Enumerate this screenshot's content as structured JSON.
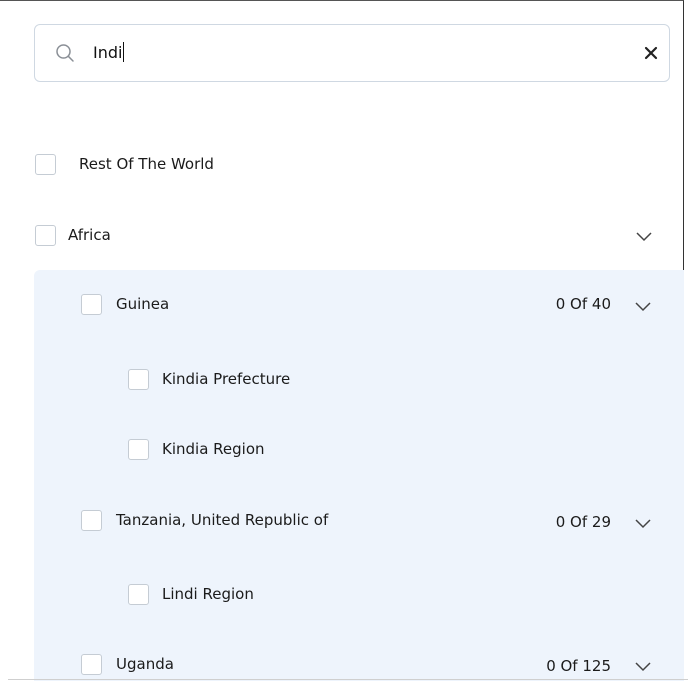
{
  "search": {
    "value": "Indi",
    "clear_icon": "close-icon",
    "search_icon": "search-icon"
  },
  "rows": {
    "rest": {
      "label": "Rest Of The World"
    },
    "africa": {
      "label": "Africa",
      "chevron": "chevron-down-icon"
    },
    "guinea": {
      "label": "Guinea",
      "count": "0 Of 40",
      "chevron": "chevron-down-icon"
    },
    "kindia_prefecture": {
      "label": "Kindia Prefecture"
    },
    "kindia_region": {
      "label": "Kindia Region"
    },
    "tanzania": {
      "label": "Tanzania, United Republic of",
      "count": "0 Of 29",
      "chevron": "chevron-down-icon"
    },
    "lindi_region": {
      "label": "Lindi Region"
    },
    "uganda": {
      "label": "Uganda",
      "count": "0 Of 125",
      "chevron": "chevron-down-icon"
    }
  },
  "colors": {
    "group_background": "#eef4fc",
    "checkbox_border": "#c5ccd4",
    "search_border": "#cfd8e2"
  }
}
